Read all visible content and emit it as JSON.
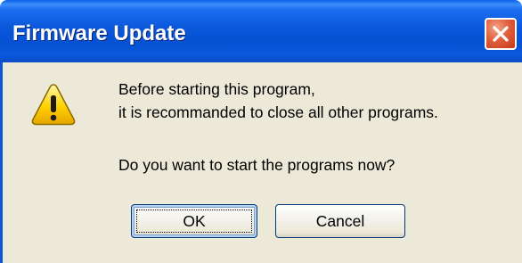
{
  "window": {
    "title": "Firmware Update",
    "close_icon": "close-icon",
    "accent": "#0a57d9"
  },
  "dialog": {
    "icon": "warning-icon",
    "icon_color": "#ffd200",
    "message_line1": "Before starting this program,",
    "message_line2": "it is recommanded to close all other programs.",
    "question": "Do you want to start the programs now?"
  },
  "buttons": {
    "ok_label": "OK",
    "cancel_label": "Cancel"
  }
}
